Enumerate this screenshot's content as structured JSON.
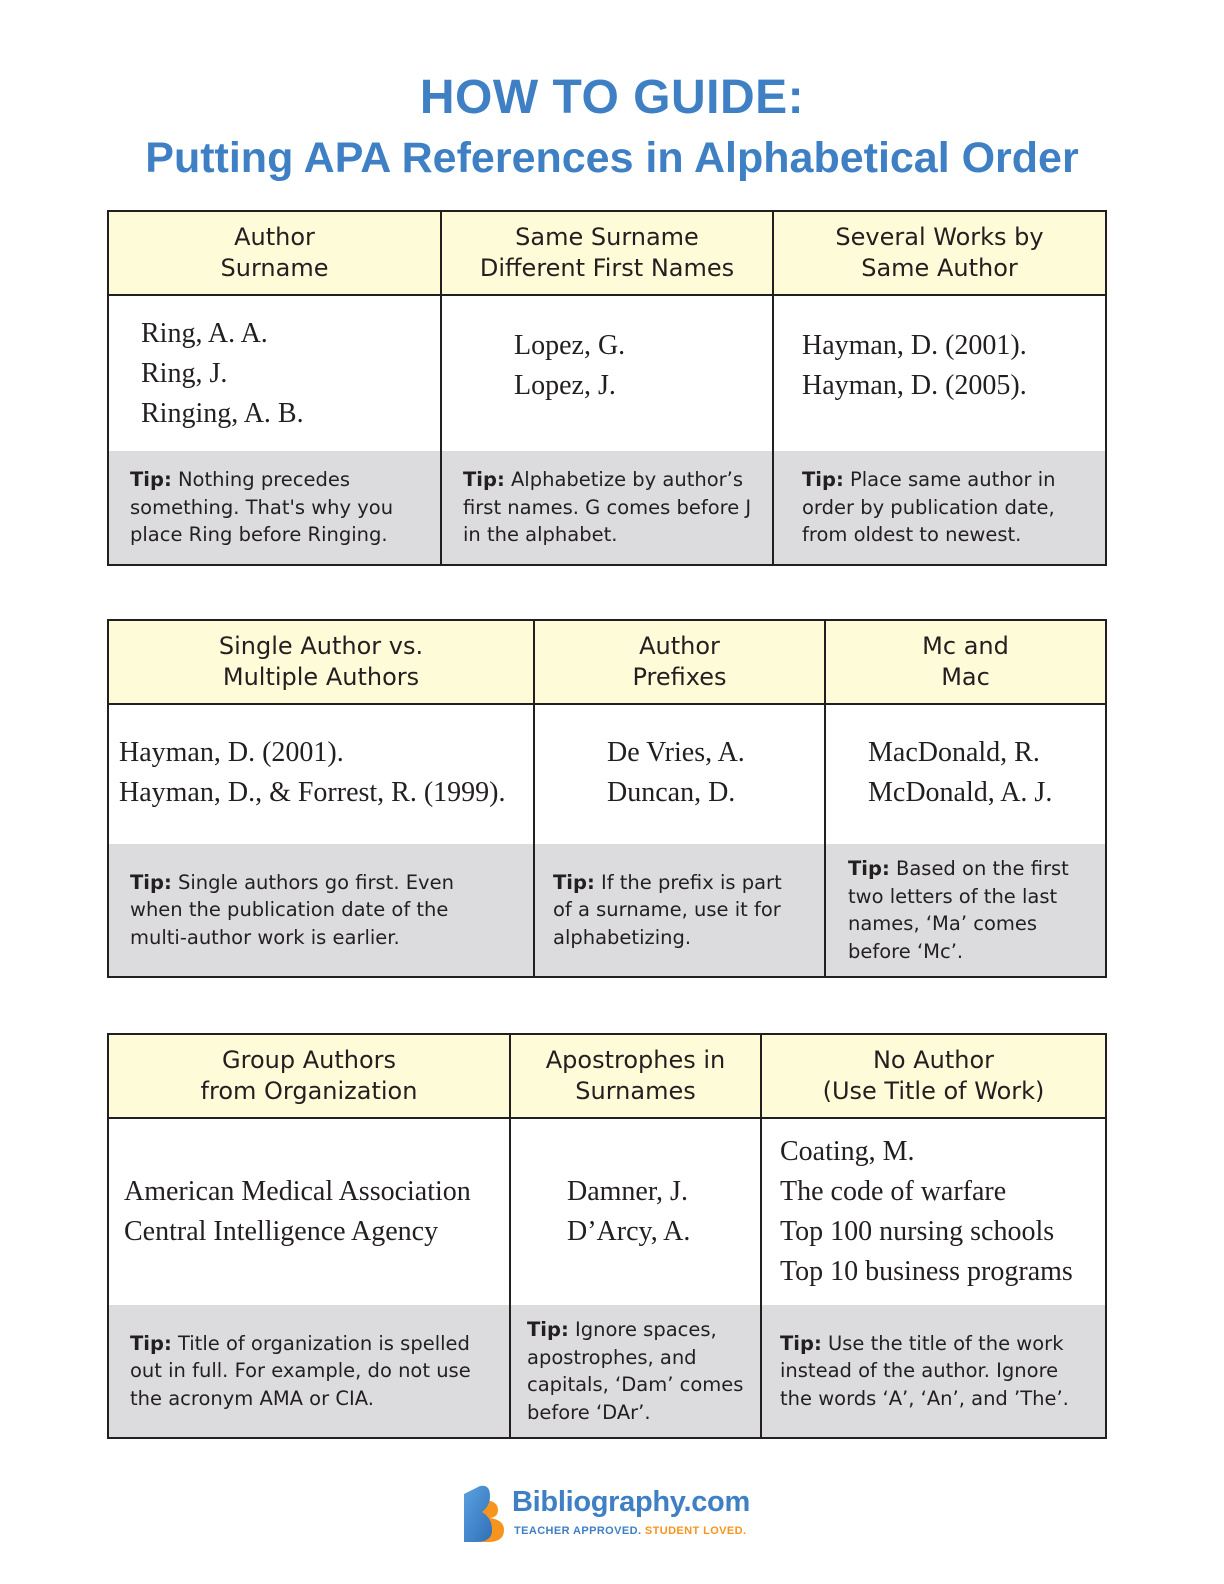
{
  "title": {
    "line1": "HOW TO GUIDE:",
    "line2": "Putting APA References in Alphabetical Order"
  },
  "colors": {
    "title_blue": "#3f80c4",
    "header_yellow": "#fefbd8",
    "tip_gray": "#dcdcde",
    "logo_orange": "#f7941d"
  },
  "tip_label": "Tip:",
  "tables": [
    {
      "columns": [
        {
          "header": [
            "Author",
            "Surname"
          ],
          "examples": [
            "Ring, A. A.",
            "Ring, J.",
            "Ringing, A. B."
          ],
          "tip": "Nothing precedes something. That's why you place Ring before Ringing."
        },
        {
          "header": [
            "Same Surname",
            "Different First Names"
          ],
          "examples": [
            "Lopez, G.",
            "Lopez, J."
          ],
          "tip": "Alphabetize by author’s first names. G comes before J in the alphabet."
        },
        {
          "header": [
            "Several Works by",
            "Same Author"
          ],
          "examples": [
            "Hayman, D. (2001).",
            "Hayman, D. (2005)."
          ],
          "tip": "Place same author in order by publication date, from oldest to newest."
        }
      ]
    },
    {
      "columns": [
        {
          "header": [
            "Single Author vs.",
            "Multiple Authors"
          ],
          "examples": [
            "Hayman, D. (2001).",
            "Hayman, D., & Forrest, R. (1999)."
          ],
          "tip": "Single authors go first. Even when the publication date of the multi-author work is earlier."
        },
        {
          "header": [
            "Author",
            "Prefixes"
          ],
          "examples": [
            "De Vries, A.",
            "Duncan, D."
          ],
          "tip": "If the prefix is part of a surname, use it for alphabetizing."
        },
        {
          "header": [
            "Mc and",
            "Mac"
          ],
          "examples": [
            "MacDonald, R.",
            "McDonald, A. J."
          ],
          "tip": "Based on the first two letters of the last names, ‘Ma’ comes before ‘Mc’."
        }
      ]
    },
    {
      "columns": [
        {
          "header": [
            "Group Authors",
            "from Organization"
          ],
          "examples": [
            "American Medical Association",
            "Central Intelligence Agency"
          ],
          "tip": "Title of organization is spelled out in full. For example, do not use the acronym AMA or CIA."
        },
        {
          "header": [
            "Apostrophes in",
            "Surnames"
          ],
          "examples": [
            "Damner, J.",
            "D’Arcy, A."
          ],
          "tip": "Ignore spaces, apostrophes, and capitals, ‘Dam’ comes before ‘DAr’."
        },
        {
          "header": [
            "No Author",
            "(Use Title of Work)"
          ],
          "examples": [
            "Coating, M.",
            "The code of warfare",
            "Top 100 nursing schools",
            "Top 10 business programs"
          ],
          "tip": "Use the title of the work instead of the author. Ignore the words ‘A’, ‘An’, and ’The’."
        }
      ]
    }
  ],
  "logo": {
    "icon": "bibliography-b-logo-icon",
    "name": "Bibliography.com",
    "tagline_part1": "TEACHER APPROVED.",
    "tagline_part2": "STUDENT LOVED."
  }
}
